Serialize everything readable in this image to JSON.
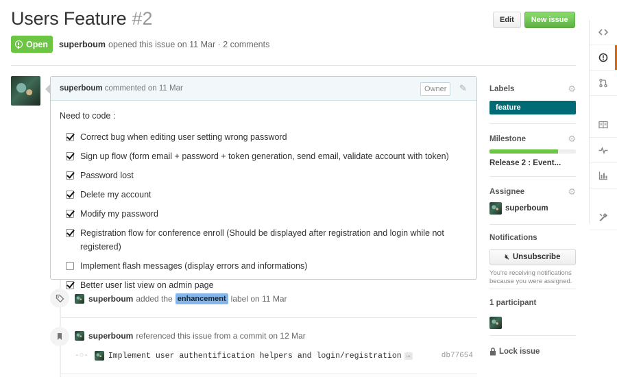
{
  "header": {
    "title": "Users Feature",
    "number": "#2",
    "edit_label": "Edit",
    "new_issue_label": "New issue"
  },
  "meta": {
    "state": "Open",
    "author": "superboum",
    "opened_text": "opened this issue on 11 Mar · 2 comments"
  },
  "comment": {
    "author": "superboum",
    "action": "commented on 11 Mar",
    "owner_badge": "Owner",
    "intro": "Need to code :",
    "tasks": [
      {
        "text": "Correct bug when editing user setting wrong password",
        "done": true
      },
      {
        "text": "Sign up flow (form email + password + token generation, send email, validate account with token)",
        "done": true
      },
      {
        "text": "Password lost",
        "done": true
      },
      {
        "text": "Delete my account",
        "done": true
      },
      {
        "text": "Modify my password",
        "done": true
      },
      {
        "text": "Registration flow for conference enroll (Should be displayed after registration and login while not registered)",
        "done": true
      },
      {
        "text": "Implement flash messages (display errors and informations)",
        "done": false
      },
      {
        "text": "Better user list view on admin page",
        "done": true
      }
    ]
  },
  "events": {
    "label_event": {
      "who": "superboum",
      "before": "added the",
      "label": "enhancement",
      "after": "label on 11 Mar"
    },
    "ref_event": {
      "who": "superboum",
      "text": "referenced this issue from a commit on 12 Mar"
    },
    "commit": {
      "message": "Implement user authentification helpers and login/registration",
      "ellipsis": "…",
      "sha": "db77654"
    }
  },
  "sidebar": {
    "labels_heading": "Labels",
    "label": "feature",
    "label_color": "#006b75",
    "milestone_heading": "Milestone",
    "milestone_progress": 0.79,
    "milestone_title": "Release 2 : Event...",
    "assignee_heading": "Assignee",
    "assignee": "superboum",
    "notifications_heading": "Notifications",
    "unsubscribe_label": "Unsubscribe",
    "notif_reason": "You're receiving notifications because you were assigned.",
    "participants_heading": "1 participant",
    "lock_label": "Lock issue"
  },
  "rail": [
    "code-icon",
    "issue-icon",
    "pull-request-icon",
    "wiki-icon",
    "pulse-icon",
    "graph-icon",
    "settings-icon"
  ]
}
